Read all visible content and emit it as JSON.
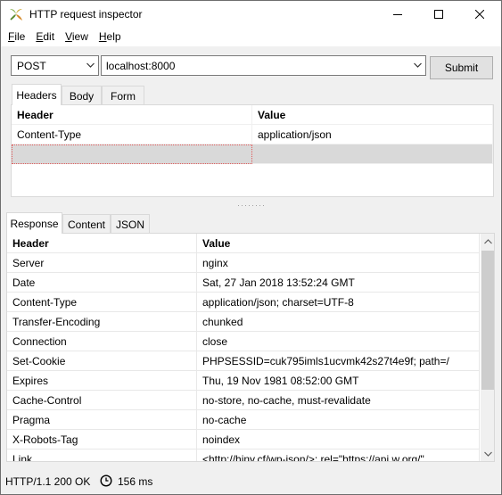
{
  "window": {
    "title": "HTTP request inspector"
  },
  "menu": [
    {
      "label": "File",
      "mnemonic": "F",
      "rest": "ile"
    },
    {
      "label": "Edit",
      "mnemonic": "E",
      "rest": "dit"
    },
    {
      "label": "View",
      "mnemonic": "V",
      "rest": "iew"
    },
    {
      "label": "Help",
      "mnemonic": "H",
      "rest": "elp"
    }
  ],
  "request": {
    "method": "POST",
    "url": "localhost:8000",
    "submit_label": "Submit",
    "tabs": [
      "Headers",
      "Body",
      "Form"
    ],
    "active_tab": "Headers",
    "columns": [
      "Header",
      "Value"
    ],
    "rows": [
      {
        "header": "Content-Type",
        "value": "application/json"
      },
      {
        "header": "",
        "value": ""
      }
    ]
  },
  "response": {
    "tabs": [
      "Response",
      "Content",
      "JSON"
    ],
    "active_tab": "Response",
    "columns": [
      "Header",
      "Value"
    ],
    "rows": [
      {
        "header": "Server",
        "value": "nginx"
      },
      {
        "header": "Date",
        "value": "Sat, 27 Jan 2018 13:52:24 GMT"
      },
      {
        "header": "Content-Type",
        "value": "application/json; charset=UTF-8"
      },
      {
        "header": "Transfer-Encoding",
        "value": "chunked"
      },
      {
        "header": "Connection",
        "value": "close"
      },
      {
        "header": "Set-Cookie",
        "value": "PHPSESSID=cuk795imls1ucvmk42s27t4e9f; path=/"
      },
      {
        "header": "Expires",
        "value": "Thu, 19 Nov 1981 08:52:00 GMT"
      },
      {
        "header": "Cache-Control",
        "value": "no-store, no-cache, must-revalidate"
      },
      {
        "header": "Pragma",
        "value": "no-cache"
      },
      {
        "header": "X-Robots-Tag",
        "value": "noindex"
      },
      {
        "header": "Link",
        "value": "<http://hiny.cf/wp-json/>; rel=\"https://api.w.org/\""
      }
    ]
  },
  "status": {
    "text": "HTTP/1.1 200 OK",
    "elapsed": "156 ms"
  },
  "colors": {
    "selection_row": "#d9d9d9",
    "focus_outline": "#e05a5a",
    "scroll_thumb": "#cdcdcd"
  }
}
